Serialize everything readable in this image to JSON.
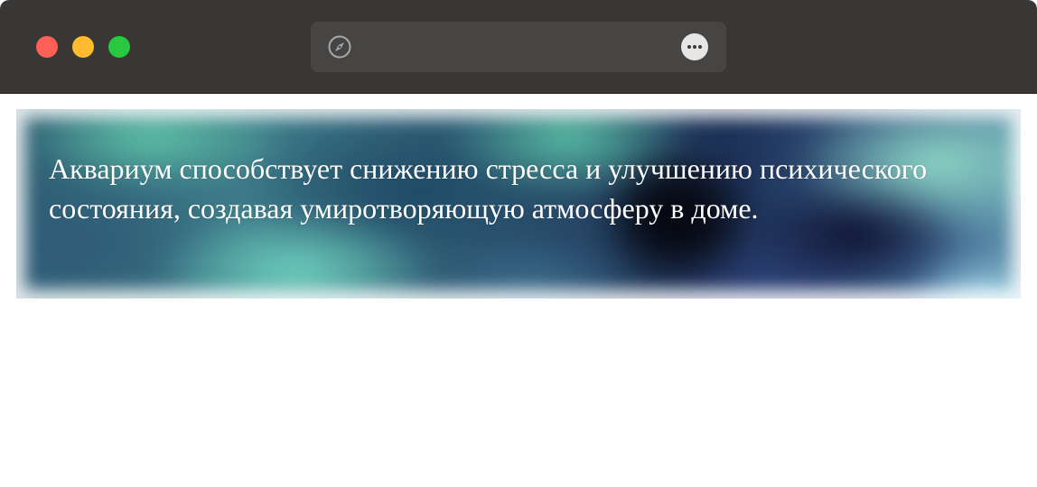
{
  "window": {
    "traffic_lights": {
      "close_color": "#fe5f57",
      "minimize_color": "#febc2e",
      "maximize_color": "#28c840"
    }
  },
  "toolbar": {
    "address_icon": "compass-icon",
    "address_text": "",
    "more_icon": "ellipsis-icon"
  },
  "content": {
    "banner_text": "Аквариум способствует снижению стресса и улучшению психического состояния, создавая умиротворяющую атмосферу в доме."
  },
  "colors": {
    "titlebar": "#383736",
    "address_bar": "#464544",
    "page_background": "#ffffff",
    "banner_text": "#ffffff"
  }
}
